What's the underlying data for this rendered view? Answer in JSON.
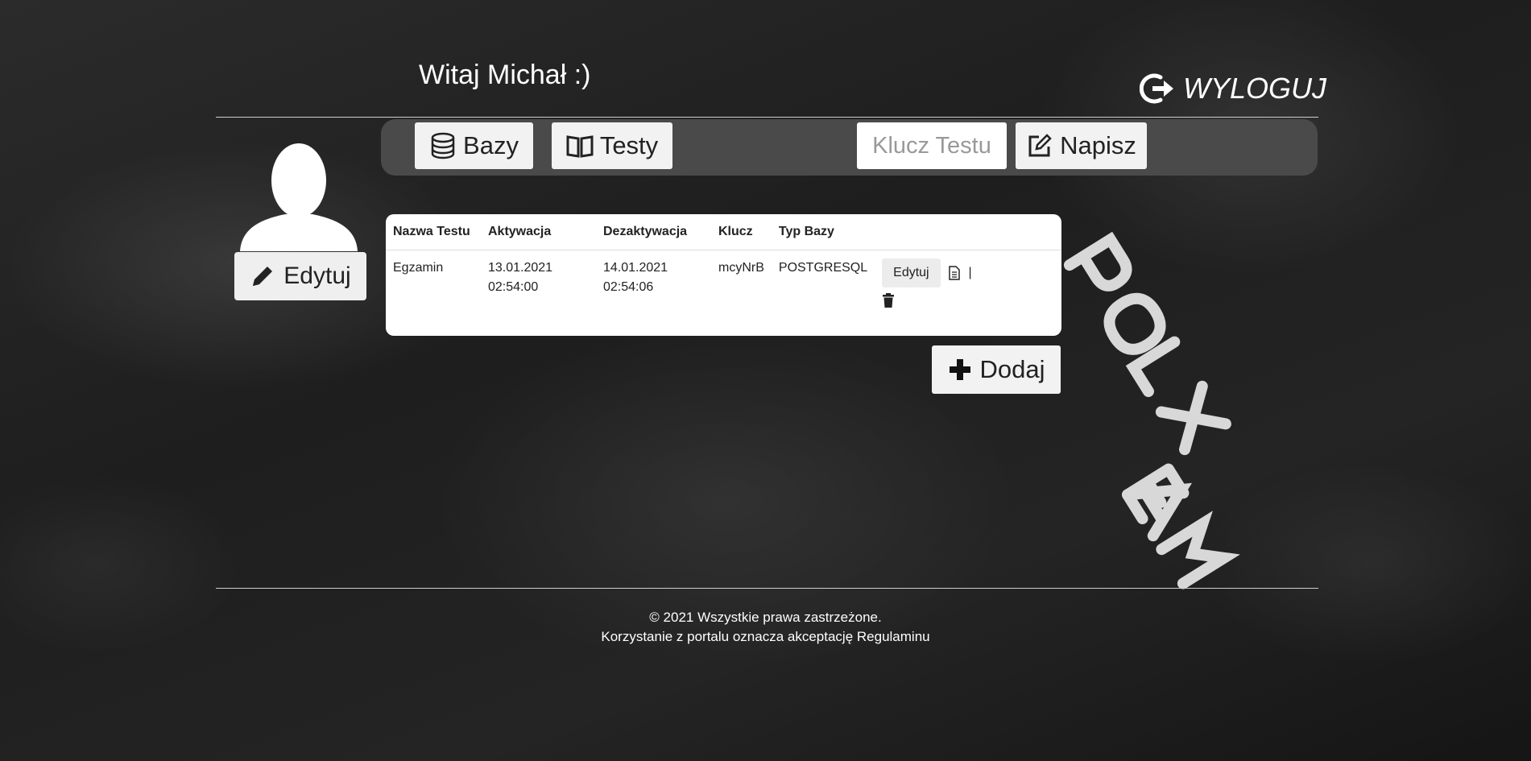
{
  "header": {
    "greeting": "Witaj Michał :)",
    "logout_label": "WYLOGUJ"
  },
  "profile": {
    "edit_label": "Edytuj"
  },
  "toolbar": {
    "bazy_label": "Bazy",
    "testy_label": "Testy",
    "key_placeholder": "Klucz Testu",
    "napisz_label": "Napisz"
  },
  "table": {
    "headers": [
      "Nazwa Testu",
      "Aktywacja",
      "Dezaktywacja",
      "Klucz",
      "Typ Bazy"
    ],
    "rows": [
      {
        "name": "Egzamin",
        "activation_date": "13.01.2021",
        "activation_time": "02:54:00",
        "deactivation_date": "14.01.2021",
        "deactivation_time": "02:54:06",
        "key": "mcyNrB",
        "db_type": "POSTGRESQL",
        "edit_label": "Edytuj",
        "separator": "|"
      }
    ]
  },
  "add_button_label": "Dodaj",
  "footer": {
    "copyright": "© 2021 Wszystkie prawa zastrzeżone.",
    "terms": "Korzystanie z portalu oznacza akceptację Regulaminu"
  },
  "colors": {
    "background": "#222222",
    "toolbar": "#4a4a4a",
    "button": "#f2f2f2",
    "text_light": "#ffffff"
  },
  "icons": [
    "logout-icon",
    "avatar-icon",
    "pencil-icon",
    "database-icon",
    "book-icon",
    "edit-note-icon",
    "document-icon",
    "trash-icon",
    "plus-icon"
  ]
}
